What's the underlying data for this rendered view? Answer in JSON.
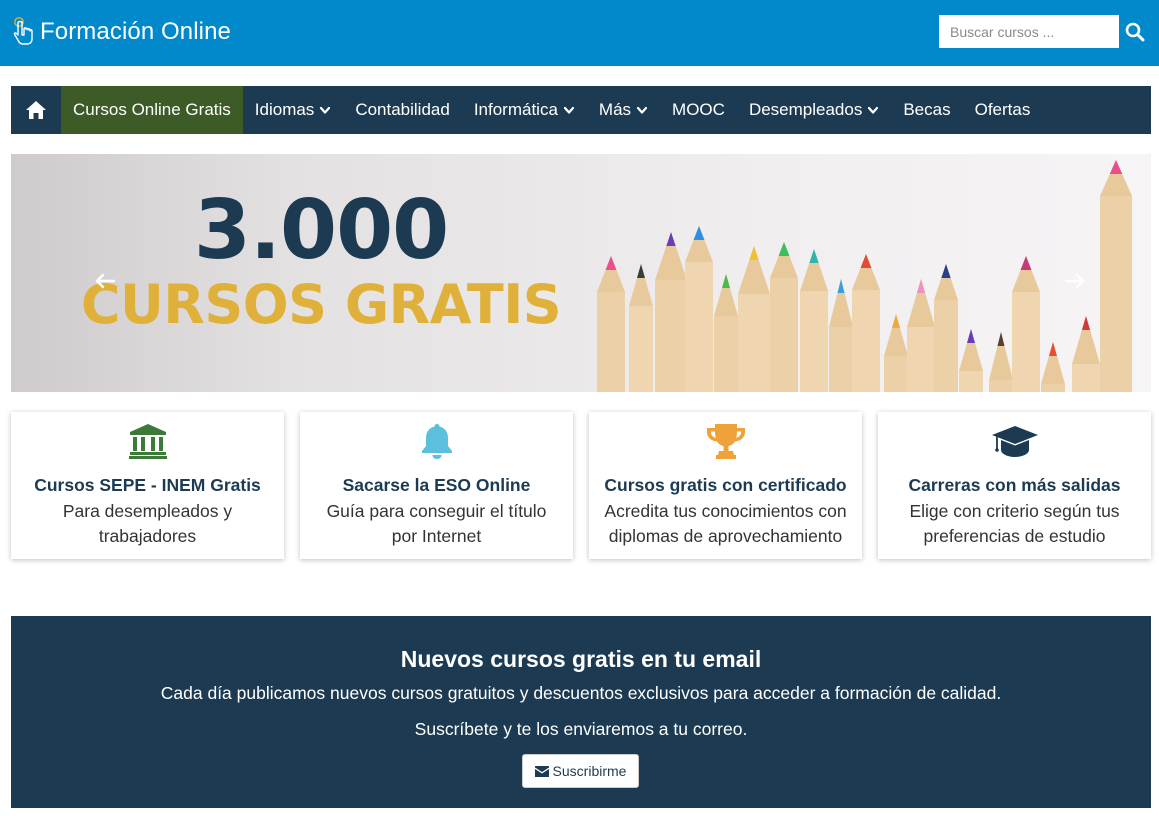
{
  "header": {
    "site_title": "Formación Online",
    "search_placeholder": "Buscar cursos ...",
    "search_value": "",
    "colors": {
      "header_bg": "#0189cb",
      "nav_bg": "#1c3b52",
      "nav_active_bg": "#3c5b26"
    }
  },
  "nav": {
    "home_icon": "home-icon",
    "items": [
      {
        "label": "Cursos Online Gratis",
        "active": true,
        "dropdown": false
      },
      {
        "label": "Idiomas",
        "active": false,
        "dropdown": true
      },
      {
        "label": "Contabilidad",
        "active": false,
        "dropdown": false
      },
      {
        "label": "Informática",
        "active": false,
        "dropdown": true
      },
      {
        "label": "Más",
        "active": false,
        "dropdown": true
      },
      {
        "label": "MOOC",
        "active": false,
        "dropdown": false
      },
      {
        "label": "Desempleados",
        "active": false,
        "dropdown": true
      },
      {
        "label": "Becas",
        "active": false,
        "dropdown": false
      },
      {
        "label": "Ofertas",
        "active": false,
        "dropdown": false
      }
    ]
  },
  "banner": {
    "big_text": "3.000",
    "sub_text": "CURSOS GRATIS",
    "colors": {
      "big": "#1c3b52",
      "sub": "#e0b13a"
    }
  },
  "cards": [
    {
      "icon": "bank-icon",
      "title": "Cursos SEPE - INEM Gratis",
      "desc": "Para desempleados y trabajadores",
      "color": "#3c7a3a"
    },
    {
      "icon": "bell-icon",
      "title": "Sacarse la ESO Online",
      "desc": "Guía para conseguir el título por Internet",
      "color": "#5bc0de"
    },
    {
      "icon": "trophy-icon",
      "title": "Cursos gratis con certificado",
      "desc": "Acredita tus conocimientos con diplomas de aprovechamiento",
      "color": "#f0a23a"
    },
    {
      "icon": "graduation-cap-icon",
      "title": "Carreras con más salidas",
      "desc": "Elige con criterio según tus preferencias de estudio",
      "color": "#1c3b52"
    }
  ],
  "newsletter": {
    "title": "Nuevos cursos gratis en tu email",
    "line1": "Cada día publicamos nuevos cursos gratuitos y descuentos exclusivos para acceder a formación de calidad.",
    "line2": "Suscríbete y te los enviaremos a tu correo.",
    "button_label": "Suscribirme",
    "button_icon": "envelope-icon"
  }
}
